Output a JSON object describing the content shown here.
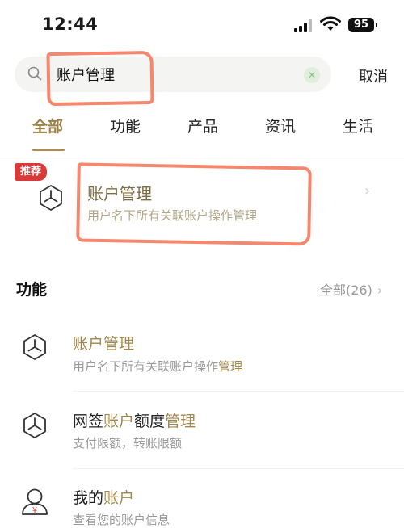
{
  "status_bar": {
    "time": "12:44",
    "battery": "95"
  },
  "search": {
    "query": "账户管理",
    "cancel_label": "取消"
  },
  "tabs": [
    {
      "label": "全部",
      "active": true
    },
    {
      "label": "功能",
      "active": false
    },
    {
      "label": "产品",
      "active": false
    },
    {
      "label": "资讯",
      "active": false
    },
    {
      "label": "生活",
      "active": false
    }
  ],
  "recommend": {
    "badge": "推荐",
    "title": "账户管理",
    "subtitle": "用户名下所有关联账户操作管理"
  },
  "functions_section": {
    "title": "功能",
    "all_label": "全部(26)",
    "items": [
      {
        "icon": "hexagon-cube-icon",
        "title_parts": [
          [
            "账户管理",
            true
          ]
        ],
        "sub_parts": [
          [
            "用户名下所有关联账户操作",
            false
          ],
          [
            "管理",
            true
          ]
        ]
      },
      {
        "icon": "hexagon-cube-icon",
        "title_parts": [
          [
            "网签",
            false
          ],
          [
            "账户",
            true
          ],
          [
            "额度",
            false
          ],
          [
            "管理",
            true
          ]
        ],
        "sub_parts": [
          [
            "支付限额，转账限额",
            false
          ]
        ]
      },
      {
        "icon": "user-yuan-icon",
        "title_parts": [
          [
            "我的",
            false
          ],
          [
            "账户",
            true
          ]
        ],
        "sub_parts": [
          [
            "查看您的账户信息",
            false
          ]
        ]
      }
    ]
  },
  "colors": {
    "accent": "#9b8048",
    "badge_red": "#d93a37",
    "annotation": "#f4876e"
  }
}
